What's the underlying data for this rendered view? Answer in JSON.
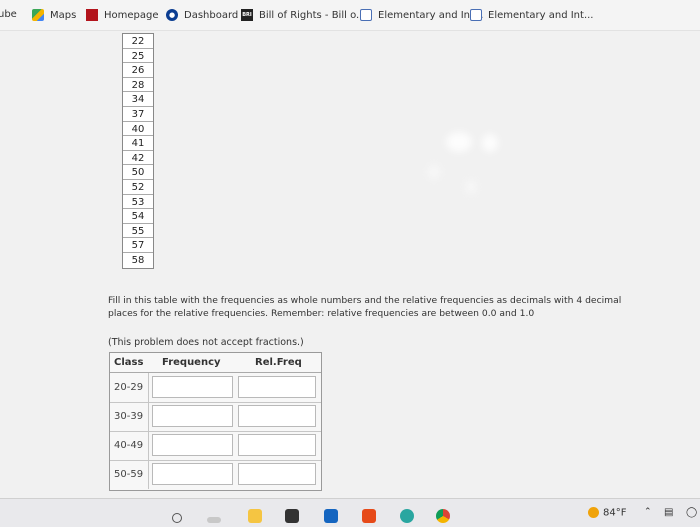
{
  "bookmarks": [
    {
      "label": "ube",
      "icon": "youtube-icon"
    },
    {
      "label": "Maps",
      "icon": "maps-icon"
    },
    {
      "label": "Homepage",
      "icon": "homepage-icon"
    },
    {
      "label": "Dashboard",
      "icon": "dashboard-icon"
    },
    {
      "label": "Bill of Rights - Bill o...",
      "icon": "bill-of-rights-icon",
      "icon_text": "BRI"
    },
    {
      "label": "Elementary and Int...",
      "icon": "document-icon"
    },
    {
      "label": "Elementary and Int...",
      "icon": "document-icon"
    }
  ],
  "data_values": [
    "22",
    "25",
    "26",
    "28",
    "34",
    "37",
    "40",
    "41",
    "42",
    "50",
    "52",
    "53",
    "54",
    "55",
    "57",
    "58"
  ],
  "instructions": "Fill in this table with the frequencies as whole numbers and the relative frequencies as decimals with 4 decimal places for the relative frequencies. Remember: relative frequencies are between 0.0 and 1.0",
  "note": "(This problem does not accept fractions.)",
  "table": {
    "headers": {
      "class": "Class",
      "frequency": "Frequency",
      "rel_freq": "Rel.Freq"
    },
    "rows": [
      {
        "class": "20-29",
        "frequency": "",
        "rel_freq": ""
      },
      {
        "class": "30-39",
        "frequency": "",
        "rel_freq": ""
      },
      {
        "class": "40-49",
        "frequency": "",
        "rel_freq": ""
      },
      {
        "class": "50-59",
        "frequency": "",
        "rel_freq": ""
      }
    ]
  },
  "taskbar": {
    "temperature": "84°F",
    "icons": [
      "start-icon",
      "search-icon",
      "file-explorer-icon",
      "store-icon",
      "mail-icon",
      "office-icon",
      "edge-icon",
      "chrome-icon"
    ]
  },
  "colors": {
    "accent_red": "#b3141c",
    "dashboard_blue": "#0b3d91"
  }
}
